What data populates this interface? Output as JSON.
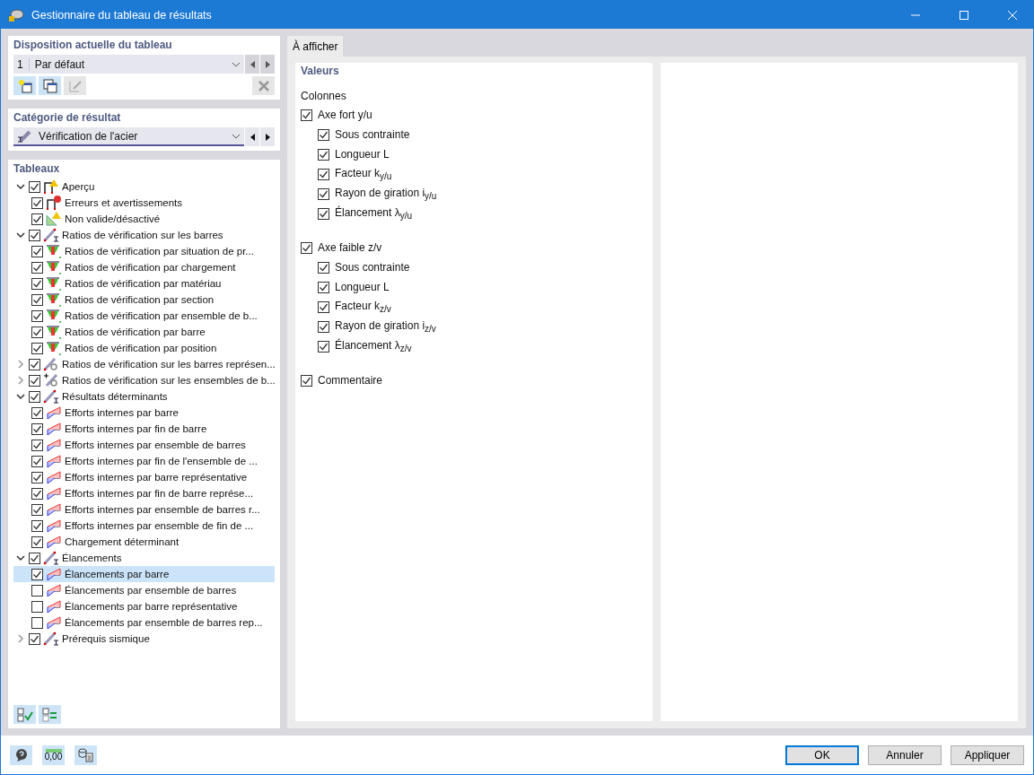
{
  "window": {
    "title": "Gestionnaire du tableau de résultats"
  },
  "layout_panel": {
    "title": "Disposition actuelle du tableau",
    "number": "1",
    "value": "Par défaut"
  },
  "category_panel": {
    "title": "Catégorie de résultat",
    "value": "Vérification de l'acier"
  },
  "tables_panel": {
    "title": "Tableaux",
    "tree": [
      {
        "label": "Aperçu",
        "kind": "overview",
        "checked": true,
        "expanded": true,
        "selected": false,
        "children": [
          {
            "label": "Erreurs et avertissements",
            "kind": "errors",
            "checked": true,
            "selected": false
          },
          {
            "label": "Non valide/désactivé",
            "kind": "invalid",
            "checked": true,
            "selected": false
          }
        ]
      },
      {
        "label": "Ratios de vérification sur les barres",
        "kind": "member",
        "checked": true,
        "expanded": true,
        "selected": false,
        "children": [
          {
            "label": "Ratios de vérification par situation de pr...",
            "kind": "ratio",
            "checked": true,
            "selected": false
          },
          {
            "label": "Ratios de vérification par chargement",
            "kind": "ratio",
            "checked": true,
            "selected": false
          },
          {
            "label": "Ratios de vérification par matériau",
            "kind": "ratio",
            "checked": true,
            "selected": false
          },
          {
            "label": "Ratios de vérification par section",
            "kind": "ratio",
            "checked": true,
            "selected": false
          },
          {
            "label": "Ratios de vérification par ensemble de b...",
            "kind": "ratio",
            "checked": true,
            "selected": false
          },
          {
            "label": "Ratios de vérification par barre",
            "kind": "ratio",
            "checked": true,
            "selected": false
          },
          {
            "label": "Ratios de vérification par position",
            "kind": "ratio",
            "checked": true,
            "selected": false
          }
        ]
      },
      {
        "label": "Ratios de vérification sur les barres représen...",
        "kind": "rep-member",
        "checked": true,
        "expanded": false,
        "selected": false
      },
      {
        "label": "Ratios de vérification sur les ensembles de b...",
        "kind": "set",
        "checked": true,
        "expanded": false,
        "selected": false
      },
      {
        "label": "Résultats déterminants",
        "kind": "member",
        "checked": true,
        "expanded": true,
        "selected": false,
        "children": [
          {
            "label": "Efforts internes par barre",
            "kind": "forces",
            "checked": true,
            "selected": false
          },
          {
            "label": "Efforts internes par fin de barre",
            "kind": "forces",
            "checked": true,
            "selected": false
          },
          {
            "label": "Efforts internes par ensemble de barres",
            "kind": "forces",
            "checked": true,
            "selected": false
          },
          {
            "label": "Efforts internes par fin de l'ensemble de ...",
            "kind": "forces",
            "checked": true,
            "selected": false
          },
          {
            "label": "Efforts internes par barre représentative",
            "kind": "forces",
            "checked": true,
            "selected": false
          },
          {
            "label": "Efforts internes par fin de barre représe...",
            "kind": "forces",
            "checked": true,
            "selected": false
          },
          {
            "label": "Efforts internes par ensemble de barres r...",
            "kind": "forces",
            "checked": true,
            "selected": false
          },
          {
            "label": "Efforts internes par ensemble de fin de ...",
            "kind": "forces",
            "checked": true,
            "selected": false
          },
          {
            "label": "Chargement déterminant",
            "kind": "forces",
            "checked": true,
            "selected": false
          }
        ]
      },
      {
        "label": "Élancements",
        "kind": "member",
        "checked": true,
        "expanded": true,
        "selected": false,
        "children": [
          {
            "label": "Élancements par barre",
            "kind": "forces",
            "checked": true,
            "selected": true
          },
          {
            "label": "Élancements par ensemble de barres",
            "kind": "forces",
            "checked": false,
            "selected": false
          },
          {
            "label": "Élancements par barre représentative",
            "kind": "forces",
            "checked": false,
            "selected": false
          },
          {
            "label": "Élancements par ensemble de barres rep...",
            "kind": "forces",
            "checked": false,
            "selected": false
          }
        ]
      },
      {
        "label": "Prérequis sismique",
        "kind": "member",
        "checked": true,
        "expanded": false,
        "selected": false
      }
    ]
  },
  "tabs": [
    {
      "label": "À afficher",
      "selected": true
    }
  ],
  "values_panel": {
    "title": "Valeurs",
    "subtitle": "Colonnes",
    "groups": [
      {
        "label": "Axe fort y/u",
        "checked": true,
        "items": [
          {
            "label": "Sous contrainte",
            "checked": true
          },
          {
            "label": "Longueur L",
            "checked": true
          },
          {
            "label": "Facteur k$_{y/u}$",
            "checked": true
          },
          {
            "label": "Rayon de giration i$_{y/u}$",
            "checked": true
          },
          {
            "label": "Élancement λ$_{y/u}$",
            "checked": true
          }
        ]
      },
      {
        "label": "Axe faible z/v",
        "checked": true,
        "items": [
          {
            "label": "Sous contrainte",
            "checked": true
          },
          {
            "label": "Longueur L",
            "checked": true
          },
          {
            "label": "Facteur k$_{z/v}$",
            "checked": true
          },
          {
            "label": "Rayon de giration i$_{z/v}$",
            "checked": true
          },
          {
            "label": "Élancement λ$_{z/v}$",
            "checked": true
          }
        ]
      },
      {
        "label": "Commentaire",
        "checked": true
      }
    ]
  },
  "footer": {
    "units_label": "0,00",
    "buttons": [
      {
        "label": "OK",
        "kind": "default"
      },
      {
        "label": "Annuler",
        "kind": "normal"
      },
      {
        "label": "Appliquer",
        "kind": "normal"
      }
    ]
  }
}
